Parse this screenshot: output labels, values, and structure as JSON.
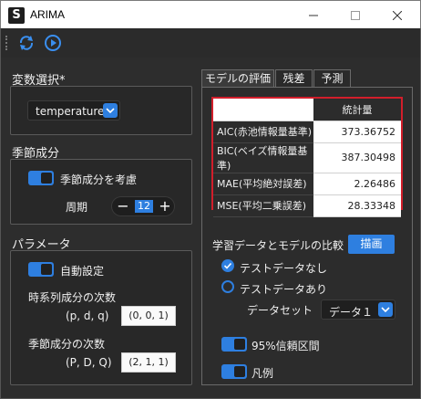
{
  "window": {
    "title": "ARIMA",
    "app_letter": "S"
  },
  "variable_group": {
    "title": "変数選択*",
    "selected": "temperature"
  },
  "seasonal_group": {
    "title": "季節成分",
    "toggle_label": "季節成分を考慮",
    "period_label": "周期",
    "period_value": "12"
  },
  "param_group": {
    "title": "パラメータ",
    "auto_label": "自動設定",
    "ts_order_label": "時系列成分の次数",
    "ts_order_vars": "(p, d, q)",
    "ts_order_value": "(0, 0, 1)",
    "seasonal_order_label": "季節成分の次数",
    "seasonal_order_vars": "(P, D, Q)",
    "seasonal_order_value": "(2, 1, 1)"
  },
  "tabs": [
    {
      "label": "モデルの評価",
      "active": true
    },
    {
      "label": "残差",
      "active": false
    },
    {
      "label": "予測",
      "active": false
    }
  ],
  "eval_table": {
    "header": "統計量",
    "rows": [
      {
        "name": "AIC(赤池情報量基準)",
        "value": "373.36752"
      },
      {
        "name": "BIC(ベイズ情報量基準)",
        "value": "387.30498"
      },
      {
        "name": "MAE(平均絶対誤差)",
        "value": "2.26486"
      },
      {
        "name": "MSE(平均二乗誤差)",
        "value": "28.33348"
      }
    ]
  },
  "compare": {
    "title": "学習データとモデルの比較",
    "draw_button": "描画",
    "radio_no_test": "テストデータなし",
    "radio_with_test": "テストデータあり",
    "dataset_label": "データセット",
    "dataset_value": "データ１"
  },
  "options": {
    "ci_label": "95%信頼区間",
    "legend_label": "凡例"
  },
  "colors": {
    "accent": "#2e7fe0",
    "highlight": "#d21e2b",
    "background": "#2d2d2d"
  }
}
